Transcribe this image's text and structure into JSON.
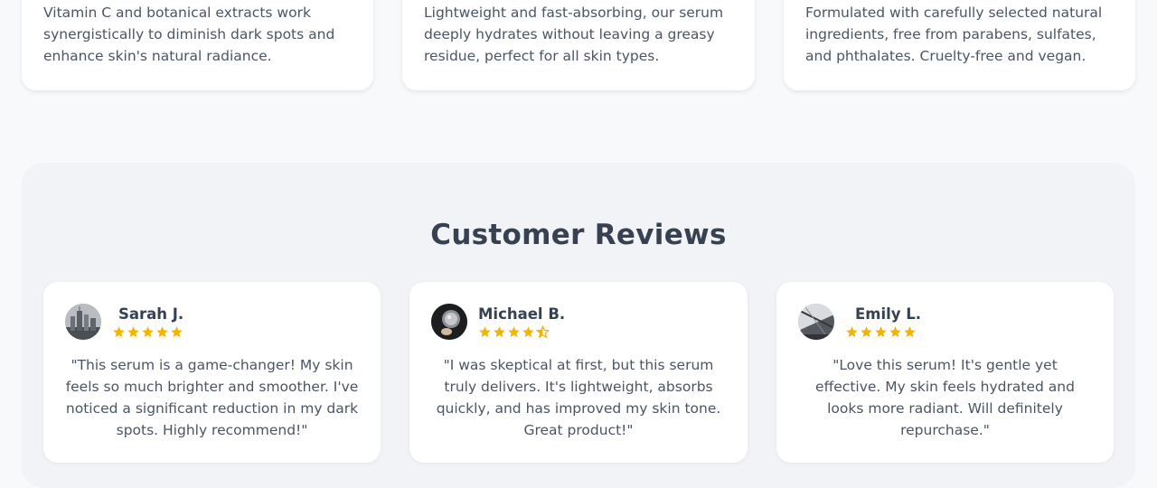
{
  "features": [
    {
      "text": "Vitamin C and botanical extracts work synergistically to diminish dark spots and enhance skin's natural radiance."
    },
    {
      "text": "Lightweight and fast-absorbing, our serum deeply hydrates without leaving a greasy residue, perfect for all skin types."
    },
    {
      "text": "Formulated with carefully selected natural ingredients, free from parabens, sulfates, and phthalates. Cruelty-free and vegan."
    }
  ],
  "reviews": {
    "title": "Customer Reviews",
    "items": [
      {
        "name": "Sarah J.",
        "rating": 5,
        "text": "\"This serum is a game-changer! My skin feels so much brighter and smoother. I've noticed a significant reduction in my dark spots. Highly recommend!\""
      },
      {
        "name": "Michael B.",
        "rating": 4.5,
        "text": "\"I was skeptical at first, but this serum truly delivers. It's lightweight, absorbs quickly, and has improved my skin tone. Great product!\""
      },
      {
        "name": "Emily L.",
        "rating": 5,
        "text": "\"Love this serum! It's gentle yet effective. My skin feels hydrated and looks more radiant. Will definitely repurchase.\""
      }
    ]
  },
  "colors": {
    "star": "#f5b301",
    "heading": "#374151",
    "body_text": "#4b5563",
    "page_bg": "#f8f9fb",
    "section_bg": "#f2f3f6"
  }
}
